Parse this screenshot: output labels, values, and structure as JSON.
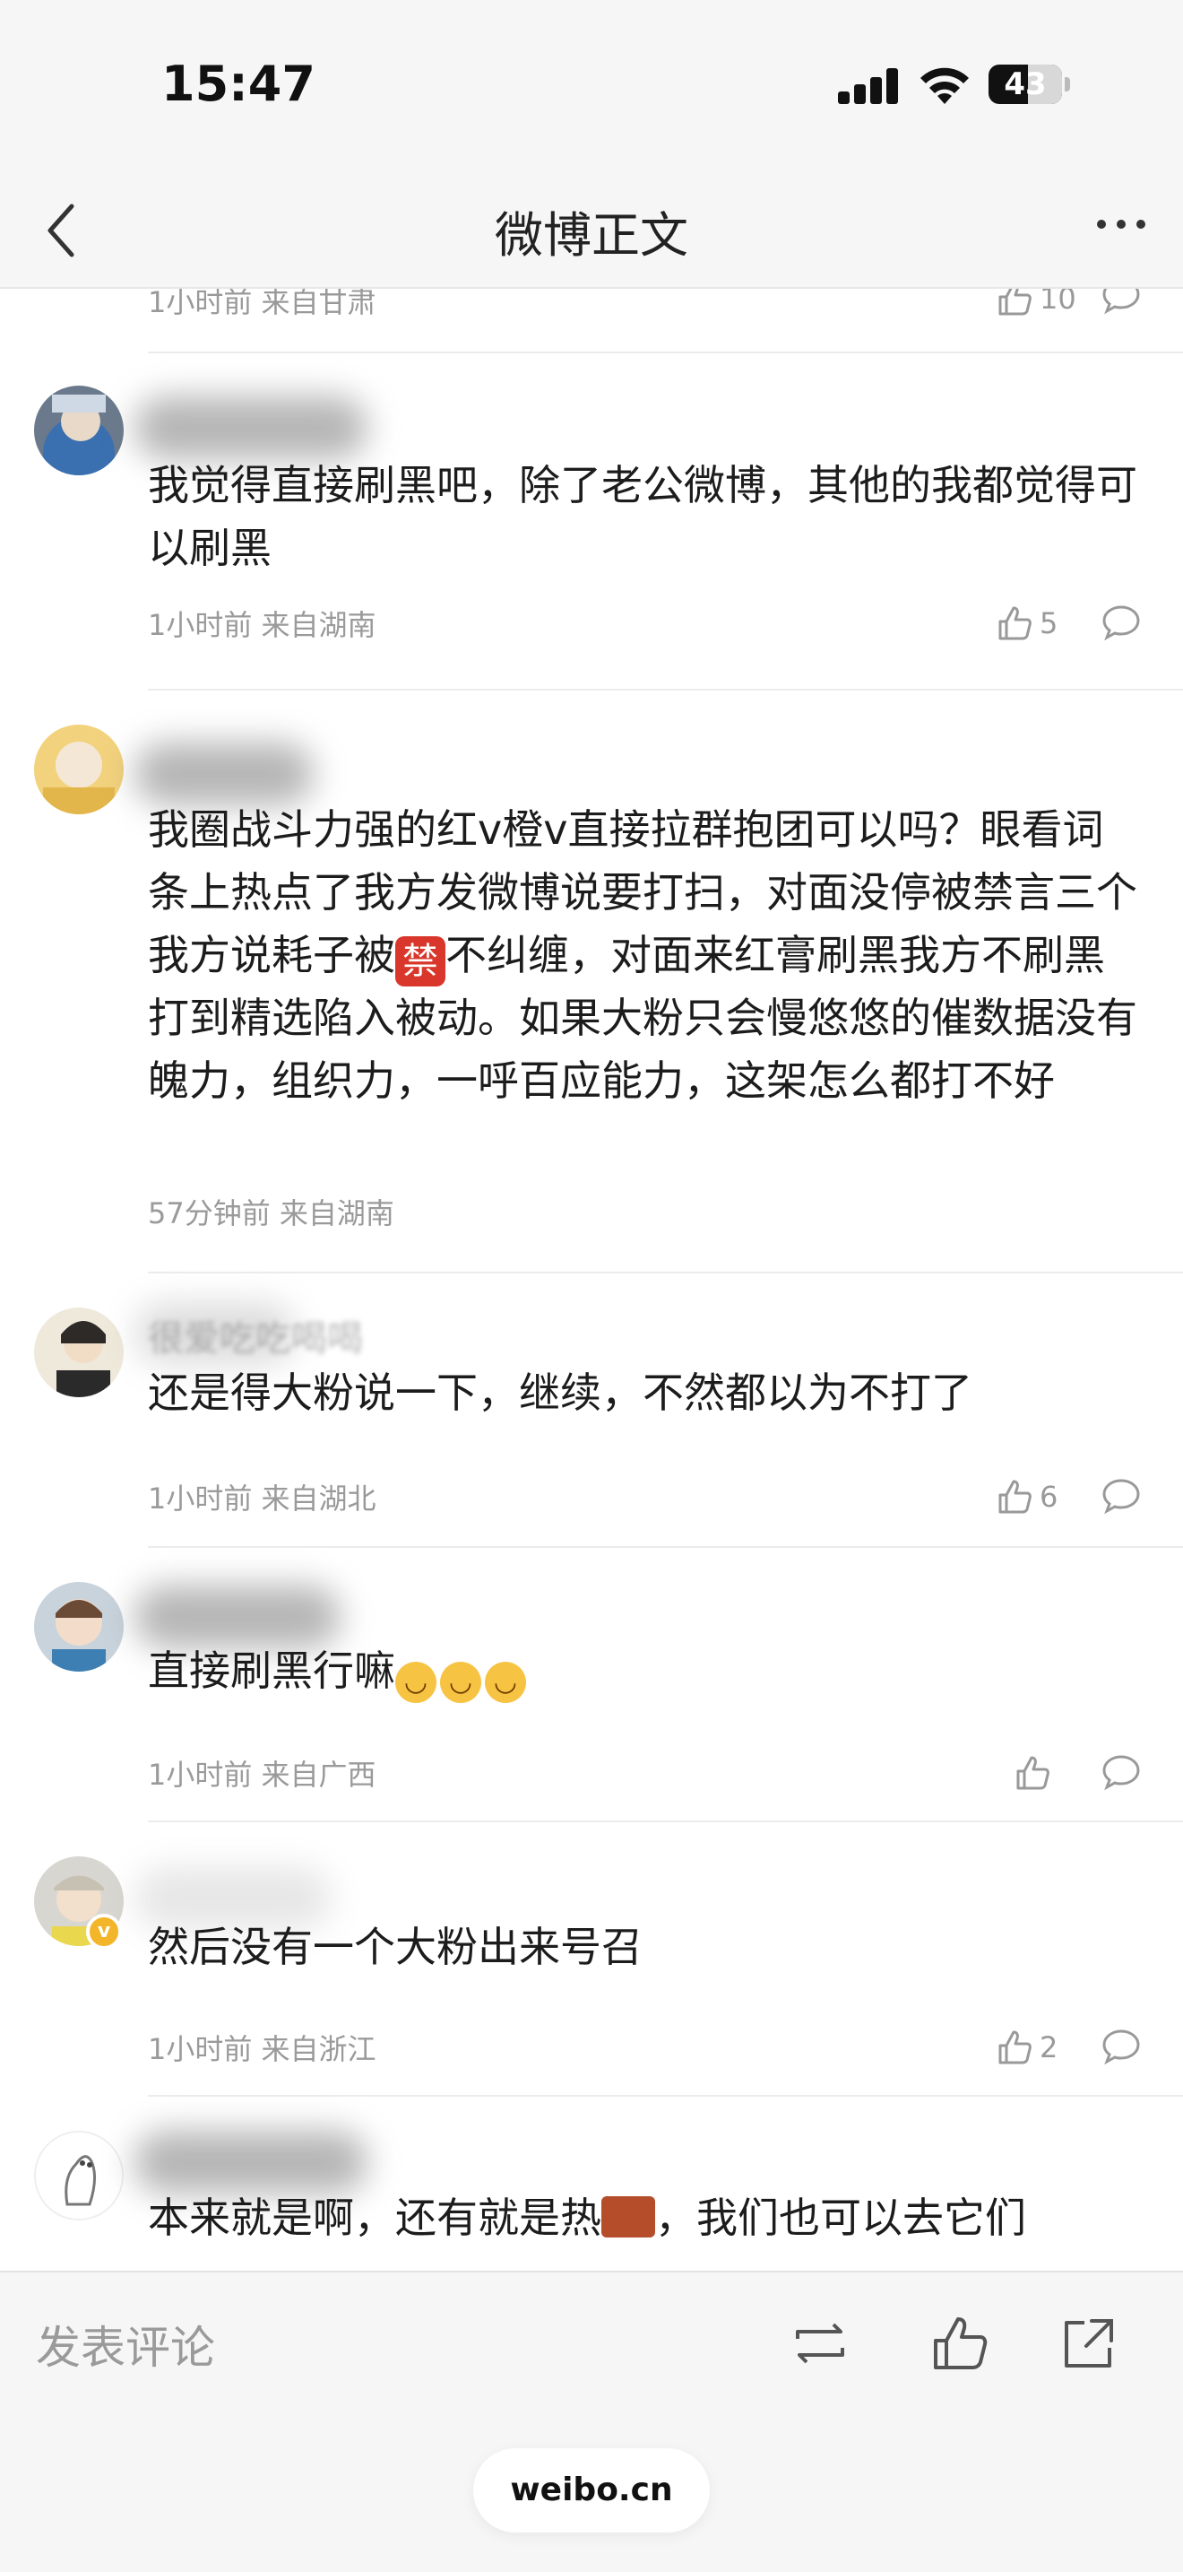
{
  "status_bar": {
    "time": "15:47",
    "battery": "43"
  },
  "nav": {
    "title": "微博正文"
  },
  "partial_top": {
    "meta": "1小时前 来自甘肃",
    "likes": "10"
  },
  "comments": [
    {
      "username": "",
      "text": "我觉得直接刷黑吧，除了老公微博，其他的我都觉得可以刷黑",
      "meta": "1小时前 来自湖南",
      "likes": "5"
    },
    {
      "username": "",
      "text_parts": [
        "我圈战斗力强的红v橙v直接拉群抱团可以吗？眼看词条上热点了我方发微博说要打扫，对面没停被禁言三个我方说耗子被",
        "禁",
        "不纠缠，对面来红膏刷黑我方不刷黑打到精选陷入被动。如果大粉只会慢悠悠的催数据没有魄力，组织力，一呼百应能力，这架怎么都打不好"
      ],
      "meta": "57分钟前 来自湖南",
      "likes": ""
    },
    {
      "username": "很爱吃吃喝喝",
      "text": "还是得大粉说一下，继续，不然都以为不打了",
      "meta": "1小时前 来自湖北",
      "likes": "6"
    },
    {
      "username": "",
      "text": "直接刷黑行嘛",
      "emoji_count": 3,
      "meta": "1小时前 来自广西",
      "likes": ""
    },
    {
      "username": "",
      "text": "然后没有一个大粉出来号召",
      "meta": "1小时前 来自浙江",
      "likes": "2"
    },
    {
      "username": "",
      "text_parts": [
        "本来就是啊，还有就是热",
        "，我们也可以去它们"
      ],
      "meta": "",
      "likes": ""
    }
  ],
  "bottom_bar": {
    "placeholder": "发表评论",
    "url": "weibo.cn"
  },
  "icons": [
    "back-arrow-icon",
    "more-icon",
    "like-icon",
    "comment-icon",
    "repost-icon",
    "share-icon"
  ],
  "colors": {
    "background": "#ffffff",
    "bar": "#f6f6f6",
    "meta": "#9a9a9a",
    "text": "#1c1c1c"
  }
}
